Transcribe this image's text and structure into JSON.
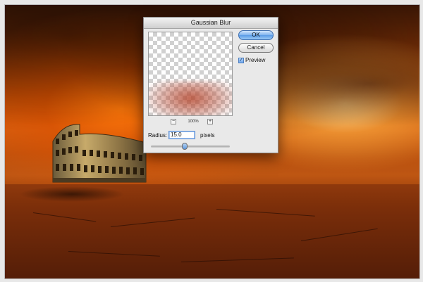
{
  "dialog": {
    "title": "Gaussian Blur",
    "ok_label": "OK",
    "cancel_label": "Cancel",
    "preview_label": "Preview",
    "preview_checked": true,
    "zoom": {
      "minus_label": "−",
      "plus_label": "+",
      "level": "100%"
    },
    "radius_label": "Radius:",
    "radius_value": "15.0",
    "radius_units": "pixels",
    "slider_fraction": 0.42
  },
  "icons": {
    "check": "checkmark-icon",
    "zoom_out": "zoom-out-icon",
    "zoom_in": "zoom-in-icon"
  },
  "colors": {
    "sky_accent": "#d36012",
    "ok_button": "#5a9be6",
    "ground": "#7d2e06"
  }
}
